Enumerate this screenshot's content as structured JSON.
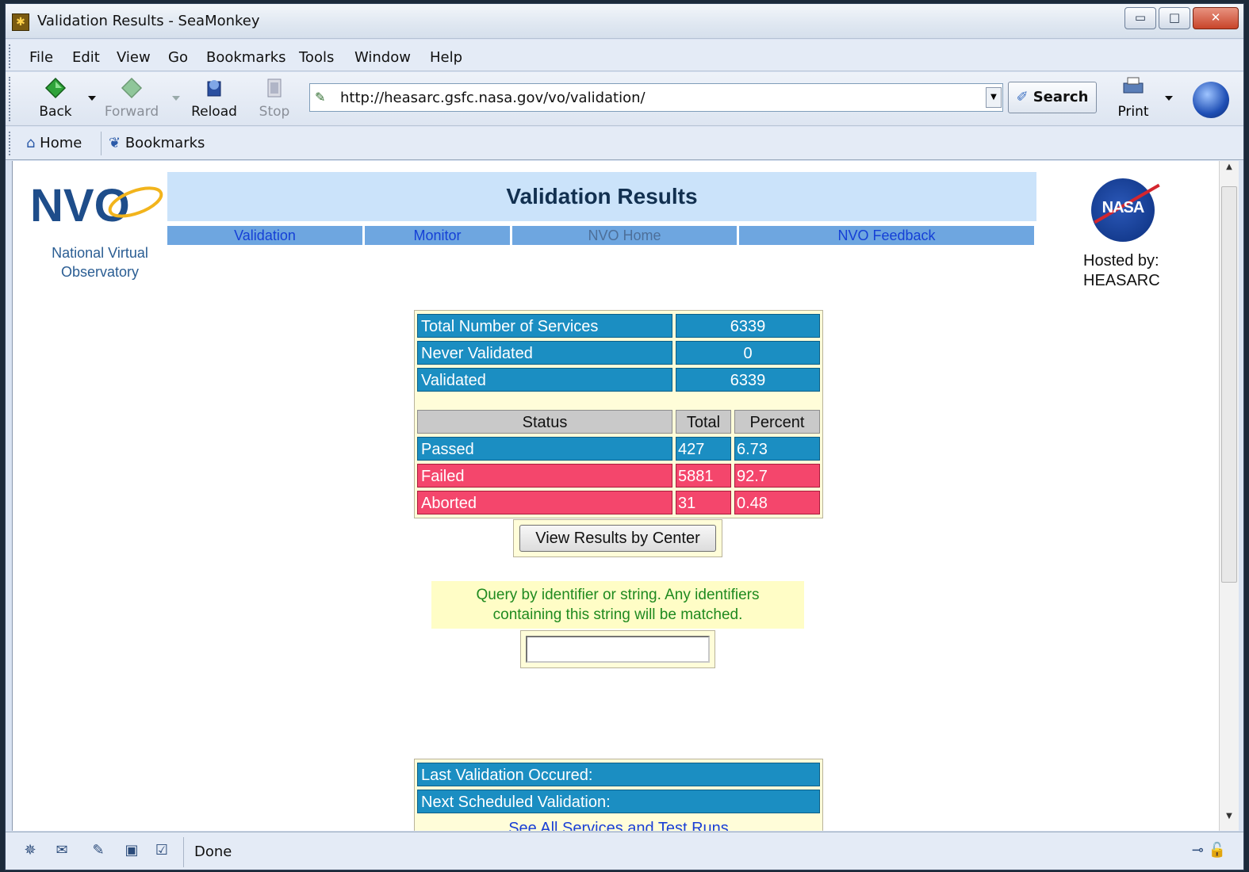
{
  "window": {
    "title": "Validation Results - SeaMonkey"
  },
  "menu": [
    "File",
    "Edit",
    "View",
    "Go",
    "Bookmarks",
    "Tools",
    "Window",
    "Help"
  ],
  "nav": {
    "back": "Back",
    "forward": "Forward",
    "reload": "Reload",
    "stop": "Stop",
    "url": "http://heasarc.gsfc.nasa.gov/vo/validation/",
    "search": "Search",
    "print": "Print"
  },
  "personal": {
    "home": "Home",
    "bookmarks": "Bookmarks"
  },
  "page": {
    "logo_text": "NVO",
    "caption_line1": "National Virtual",
    "caption_line2": "Observatory",
    "title": "Validation Results",
    "links": [
      "Validation",
      "Monitor",
      "NVO Home",
      "NVO Feedback"
    ],
    "nasa_text": "NASA",
    "hosted_line1": "Hosted by:",
    "hosted_line2": "HEASARC"
  },
  "stats": {
    "summary": [
      {
        "label": "Total Number of Services",
        "value": "6339"
      },
      {
        "label": "Never Validated",
        "value": "0"
      },
      {
        "label": "Validated",
        "value": "6339"
      }
    ],
    "headers": [
      "Status",
      "Total",
      "Percent"
    ],
    "rows": [
      {
        "status": "Passed",
        "total": "427",
        "percent": "6.73"
      },
      {
        "status": "Failed",
        "total": "5881",
        "percent": "92.7"
      },
      {
        "status": "Aborted",
        "total": "31",
        "percent": "0.48"
      }
    ]
  },
  "view_center_button": "View Results by Center",
  "query": {
    "line1": "Query by identifier or string. Any identifiers",
    "line2": "containing this string will be matched.",
    "value": ""
  },
  "schedule": {
    "last": "Last Validation Occured:",
    "next": "Next Scheduled Validation:",
    "link": "See All Services and Test Runs"
  },
  "status": {
    "text": "Done"
  },
  "colors": {
    "teal": "#1b8ec2",
    "red": "#f4466c",
    "banner": "#cbe3fa",
    "nav_link_bg": "#6ea6e0"
  }
}
